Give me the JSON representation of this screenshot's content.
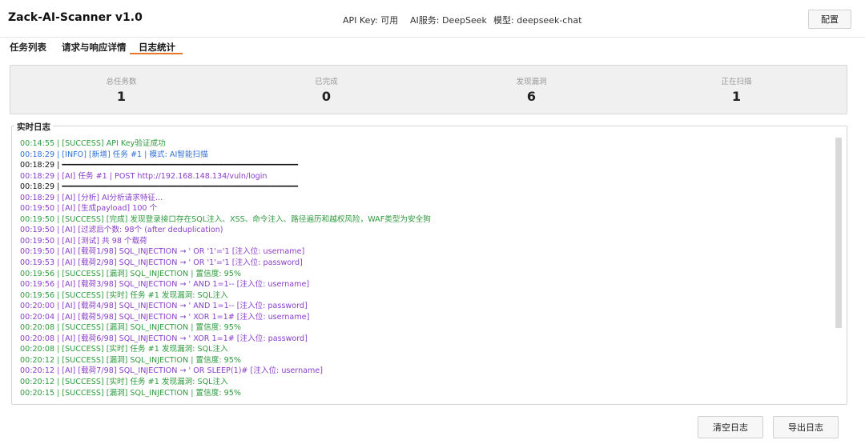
{
  "header": {
    "title": "Zack-AI-Scanner v1.0",
    "api_key": "API Key: 可用",
    "ai_service": "AI服务: DeepSeek",
    "model": "模型: deepseek-chat",
    "config_label": "配置"
  },
  "tabs": [
    {
      "label": "任务列表"
    },
    {
      "label": "请求与响应详情"
    },
    {
      "label": "日志统计"
    }
  ],
  "active_tab": "日志统计",
  "stats": [
    {
      "label": "总任务数",
      "value": "1"
    },
    {
      "label": "已完成",
      "value": "0"
    },
    {
      "label": "发现漏洞",
      "value": "6"
    },
    {
      "label": "正在扫描",
      "value": "1"
    }
  ],
  "log": {
    "title": "实时日志",
    "lines": [
      {
        "type": "success",
        "text": "00:14:55 | [SUCCESS] API Key验证成功"
      },
      {
        "type": "info",
        "text": "00:18:29 | [INFO] [新增] 任务 #1 | 模式: AI智能扫描"
      },
      {
        "type": "sep",
        "text": "00:18:29 | ━━━━━━━━━━━━━━━━━━━━━━━━━━━━━━━━━━━━━━━━━━━━━━━━━━━"
      },
      {
        "type": "ai",
        "text": "00:18:29 | [AI] 任务 #1 | POST http://192.168.148.134/vuln/login"
      },
      {
        "type": "sep",
        "text": "00:18:29 | ━━━━━━━━━━━━━━━━━━━━━━━━━━━━━━━━━━━━━━━━━━━━━━━━━━━"
      },
      {
        "type": "ai",
        "text": "00:18:29 | [AI] [分析] AI分析请求特征..."
      },
      {
        "type": "ai",
        "text": "00:19:50 | [AI] [生成payload] 100 个"
      },
      {
        "type": "success",
        "text": "00:19:50 | [SUCCESS] [完成] 发现登录接口存在SQL注入、XSS、命令注入、路径遍历和越权风险，WAF类型为安全狗"
      },
      {
        "type": "ai",
        "text": "00:19:50 | [AI] [过滤后个数: 98个 (after deduplication)"
      },
      {
        "type": "ai",
        "text": "00:19:50 | [AI] [测试] 共 98 个载荷"
      },
      {
        "type": "ai",
        "text": "00:19:50 | [AI] [载荷1/98] SQL_INJECTION → ' OR '1'='1 [注入位: username]"
      },
      {
        "type": "ai",
        "text": "00:19:53 | [AI] [载荷2/98] SQL_INJECTION → ' OR '1'='1 [注入位: password]"
      },
      {
        "type": "success",
        "text": "00:19:56 | [SUCCESS] [漏洞] SQL_INJECTION | 置信度: 95%"
      },
      {
        "type": "ai",
        "text": "00:19:56 | [AI] [载荷3/98] SQL_INJECTION → ' AND 1=1-- [注入位: username]"
      },
      {
        "type": "success",
        "text": "00:19:56 | [SUCCESS] [实时] 任务 #1 发现漏洞: SQL注入"
      },
      {
        "type": "ai",
        "text": "00:20:00 | [AI] [载荷4/98] SQL_INJECTION → ' AND 1=1-- [注入位: password]"
      },
      {
        "type": "ai",
        "text": "00:20:04 | [AI] [载荷5/98] SQL_INJECTION → ' XOR 1=1# [注入位: username]"
      },
      {
        "type": "success",
        "text": "00:20:08 | [SUCCESS] [漏洞] SQL_INJECTION | 置信度: 95%"
      },
      {
        "type": "ai",
        "text": "00:20:08 | [AI] [载荷6/98] SQL_INJECTION → ' XOR 1=1# [注入位: password]"
      },
      {
        "type": "success",
        "text": "00:20:08 | [SUCCESS] [实时] 任务 #1 发现漏洞: SQL注入"
      },
      {
        "type": "success",
        "text": "00:20:12 | [SUCCESS] [漏洞] SQL_INJECTION | 置信度: 95%"
      },
      {
        "type": "ai",
        "text": "00:20:12 | [AI] [载荷7/98] SQL_INJECTION → ' OR SLEEP(1)# [注入位: username]"
      },
      {
        "type": "success",
        "text": "00:20:12 | [SUCCESS] [实时] 任务 #1 发现漏洞: SQL注入"
      },
      {
        "type": "success",
        "text": "00:20:15 | [SUCCESS] [漏洞] SQL_INJECTION | 置信度: 95%"
      }
    ]
  },
  "buttons": {
    "clear_log": "清空日志",
    "export_log": "导出日志"
  },
  "colors": {
    "success": "#2e9a3e",
    "info": "#2f6fd6",
    "ai": "#8a3ec8",
    "tab_accent": "#e8772e"
  }
}
